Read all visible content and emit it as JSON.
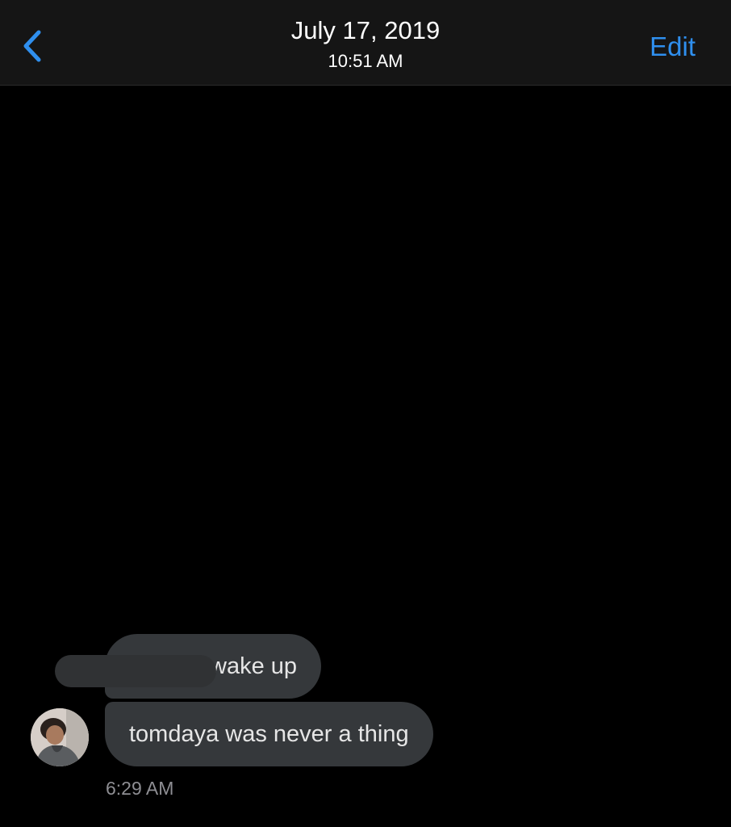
{
  "header": {
    "date": "July 17, 2019",
    "time": "10:51 AM",
    "edit_label": "Edit",
    "back_icon": "chevron-left-icon"
  },
  "messages": [
    {
      "text": "wake up"
    },
    {
      "text": "tomdaya was never a thing"
    }
  ],
  "footer": {
    "timestamp": "6:29 AM"
  },
  "colors": {
    "accent": "#2f8fee",
    "bubble": "#35383b",
    "background": "#000000",
    "header": "#151515"
  }
}
